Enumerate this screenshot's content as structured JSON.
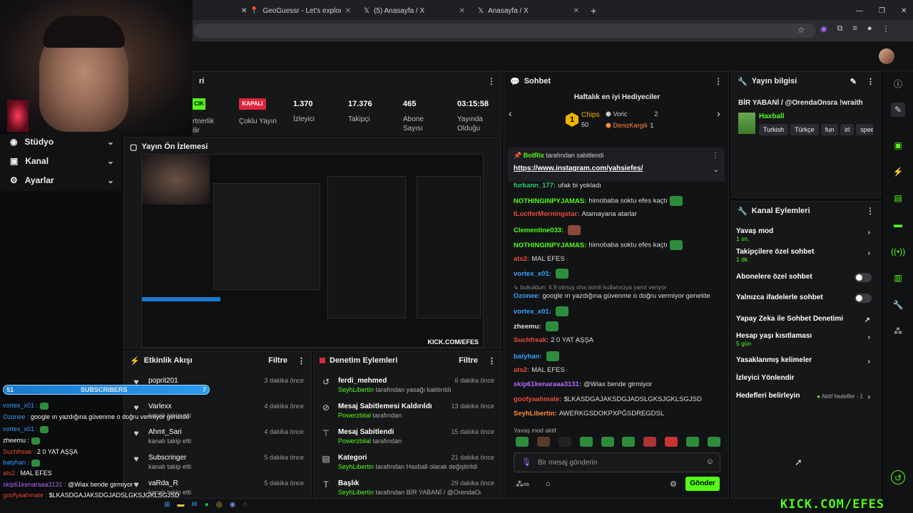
{
  "browser": {
    "tabs": [
      {
        "title": "GeoGuessr - Let's explore the w",
        "icon": "map-pin-icon"
      },
      {
        "title": "(5) Anasayfa / X",
        "icon": "x-logo-icon"
      },
      {
        "title": "Anasayfa / X",
        "icon": "x-logo-icon"
      }
    ],
    "new_tab": "+"
  },
  "left_menu": [
    {
      "label": "Stüdyo",
      "icon": "studio-icon"
    },
    {
      "label": "Kanal",
      "icon": "channel-icon"
    },
    {
      "label": "Ayarlar",
      "icon": "gear-icon"
    }
  ],
  "stats": {
    "partial_title": "ri",
    "partnerlik_badge": "CIK",
    "partnerlik_label": "rtnerlik\nilir",
    "coklu_badge": "KAPALI",
    "coklu_label": "Çoklu Yayın",
    "viewers_value": "1.370",
    "viewers_label": "İzleyici",
    "followers_value": "17.376",
    "followers_label": "Takipçi",
    "subs_value": "465",
    "subs_label": "Abone\nSayısı",
    "uptime_value": "03:15:58",
    "uptime_label": "Yayında\nOlduğu"
  },
  "preview": {
    "title": "Yayın Ön İzlemesi"
  },
  "activity": {
    "title": "Etkinlik Akışı",
    "filter": "Filtre",
    "rows": [
      {
        "name": "poprit201",
        "sub": "",
        "time": "3 dakika önce"
      },
      {
        "name": "Varlexx",
        "sub": "kanalı takip etti",
        "time": "4 dakika önce"
      },
      {
        "name": "Ahmt_Sari",
        "sub": "kanalı takip etti",
        "time": "4 dakika önce"
      },
      {
        "name": "Subscringer",
        "sub": "kanalı takip etti",
        "time": "5 dakika önce"
      },
      {
        "name": "vaRda_R",
        "sub": "kanalı takip etti",
        "time": "5 dakika önce"
      }
    ]
  },
  "moderation": {
    "title": "Denetim Eylemleri",
    "filter": "Filtre",
    "rows": [
      {
        "name": "ferdi_mehmed",
        "user": "SeyhLibertin",
        "rest": "tarafından yasağı kaldırıldı",
        "time": "6 dakika önce",
        "icon": "unban-icon"
      },
      {
        "name": "Mesaj Sabitlemesi Kaldırıldı",
        "user": "Powerzbilal",
        "rest": "tarafından",
        "time": "13 dakika önce",
        "icon": "unpin-icon"
      },
      {
        "name": "Mesaj Sabitlendi",
        "user": "Powerzbilal",
        "rest": "tarafından",
        "time": "15 dakika önce",
        "icon": "pin-icon"
      },
      {
        "name": "Kategori",
        "user": "SeyhLibertin",
        "rest": "tarafından Haxball olarak değiştirildi",
        "time": "21 dakika önce",
        "icon": "category-icon"
      },
      {
        "name": "Başlık",
        "user": "SeyhLibertin",
        "rest": "tarafından BİR YABANİ / @OrendaOnsra",
        "time": "29 dakika önce",
        "icon": "title-icon"
      }
    ]
  },
  "chat": {
    "title": "Sohbet",
    "gifters_title": "Haftalık en iyi Hediyeciler",
    "gifters": [
      {
        "rank": "1",
        "name": "Chips",
        "amount": "50"
      },
      {
        "rank": "",
        "name": "Voric",
        "amount": "2"
      },
      {
        "rank": "",
        "name": "DenizKargili",
        "amount": "1"
      }
    ],
    "pinned_by": "BotRix",
    "pinned_suffix": "tarafından sabitlendi",
    "pinned_link": "https://www.instagram.com/yahsiefes/",
    "messages": [
      {
        "user": "furkann_177:",
        "color": "#2ecc71",
        "text": "ufak bi yokladı"
      },
      {
        "user": "NOTHINGINPYJAMAS:",
        "color": "#53fc18",
        "text": "himobaba soktu efes kaçtı"
      },
      {
        "user": "ILuciferMorningstar:",
        "color": "#e74c3c",
        "text": "Atamayana atarlar"
      },
      {
        "user": "Clementine033:",
        "color": "#53fc18",
        "text": ""
      },
      {
        "user": "NOTHINGINPYJAMAS:",
        "color": "#53fc18",
        "text": "himobaba soktu efes kaçtı"
      },
      {
        "user": "ats2:",
        "color": "#e74c3c",
        "text": "MAL EFES"
      },
      {
        "user": "vortex_x01:",
        "color": "#3aa0ff",
        "text": ""
      },
      {
        "user": "bukuldun:",
        "color": "#888888",
        "text": "4.9 olmuş oha isimli kullanıcıya yanıt veriyor"
      },
      {
        "user": "Ozonee:",
        "color": "#3aa0ff",
        "text": "google ın yazdığına güvenme o doğru vermiyor genelde"
      },
      {
        "user": "vortex_x01:",
        "color": "#3aa0ff",
        "text": ""
      },
      {
        "user": "zheemu:",
        "color": "#dddddd",
        "text": ""
      },
      {
        "user": "Suchfreak:",
        "color": "#e74c3c",
        "text": "2 0 YAT AŞŞA"
      },
      {
        "user": "batyhan:",
        "color": "#3aa0ff",
        "text": ""
      },
      {
        "user": "ats2:",
        "color": "#e74c3c",
        "text": "MAL EFES"
      },
      {
        "user": "skip61kenaraaa3131:",
        "color": "#b36bff",
        "text": "@Wiax bende girmiyor"
      },
      {
        "user": "goofyaahmate:",
        "color": "#e74c3c",
        "text": "$LKASDGAJAKSDGJADSLGKSJGKLSGJSD"
      },
      {
        "user": "SeyhLibertin:",
        "color": "#ff8a3a",
        "text": "AWERKGSDOKPXPĞSDREGDSL"
      }
    ],
    "slow_mode": "Yavaş mod aktif",
    "input_placeholder": "Bir mesaj gönderin",
    "send": "Gönder"
  },
  "stream_info": {
    "title": "Yayın bilgisi",
    "stream_title": "BİR YABANİ / @OrendaOnsra !wraith",
    "category": "Haxball",
    "tags": [
      "Turkish",
      "Türkçe",
      "fun",
      "irl",
      "spee"
    ]
  },
  "channel_actions": {
    "title": "Kanal Eylemleri",
    "items": [
      {
        "label": "Yavaş mod",
        "sub": "1 sn.",
        "ctrl": "chevron"
      },
      {
        "label": "Takipçilere özel sohbet",
        "sub": "1 dk.",
        "ctrl": "chevron"
      },
      {
        "label": "Abonelere özel sohbet",
        "sub": "",
        "ctrl": "toggle"
      },
      {
        "label": "Yalnızca ifadelerle sohbet",
        "sub": "",
        "ctrl": "toggle"
      },
      {
        "label": "Yapay Zeka ile Sohbet Denetimi",
        "sub": "",
        "ctrl": "external"
      },
      {
        "label": "Hesap yaşı kısıtlaması",
        "sub": "5 gün",
        "ctrl": "chevron"
      },
      {
        "label": "Yasaklanmış kelimeler",
        "sub": "",
        "ctrl": "chevron"
      },
      {
        "label": "İzleyici Yönlendir",
        "sub": "",
        "ctrl": "none"
      },
      {
        "label": "Hedefleri belirleyin",
        "sub": "",
        "ctrl": "chevron",
        "extra": "Aktif hedefler - 1"
      }
    ]
  },
  "overlay": {
    "sub_count": "51",
    "sub_label": "SUBSCRIBERS",
    "sub_goal": "7",
    "watermark": "KICK.COM/EFES",
    "lines": [
      {
        "user": "vortex_x01 :",
        "color": "#3aa0ff",
        "text": ""
      },
      {
        "user": "Ozonee :",
        "color": "#3aa0ff",
        "text": "google ın yazdığına güvenme o doğru vermiyor genelde"
      },
      {
        "user": "vortex_x01 :",
        "color": "#3aa0ff",
        "text": ""
      },
      {
        "user": "zheemu :",
        "color": "#ffffff",
        "text": ""
      },
      {
        "user": "Suchfreak :",
        "color": "#e74c3c",
        "text": "2 0 YAT AŞŞA"
      },
      {
        "user": "batyhan :",
        "color": "#3aa0ff",
        "text": ""
      },
      {
        "user": "ats2 :",
        "color": "#e74c3c",
        "text": "MAL EFES"
      },
      {
        "user": "skip61kenaraaa3131 :",
        "color": "#b36bff",
        "text": "@Wiax bende girmiyor"
      },
      {
        "user": "goofyaahmate :",
        "color": "#e74c3c",
        "text": "$LKASDGAJAKSDGJADSLGKSJGKLSGJSD"
      }
    ]
  },
  "colors": {
    "accent": "#53fc18",
    "danger": "#e0243c",
    "bg": "#0b0c0d",
    "panel": "#161718"
  }
}
